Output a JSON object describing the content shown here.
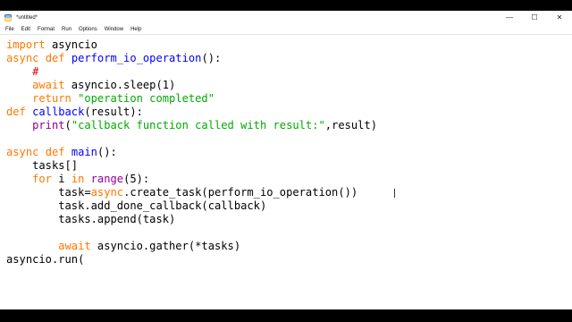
{
  "window": {
    "title": "*untitled*",
    "controls": {
      "minimize": "—",
      "maximize": "☐",
      "close": "✕"
    }
  },
  "menu": [
    "File",
    "Edit",
    "Format",
    "Run",
    "Options",
    "Window",
    "Help"
  ],
  "code": {
    "l1": {
      "a": "import",
      "b": " asyncio"
    },
    "l2": {
      "a": "async",
      "b": " ",
      "c": "def",
      "d": " ",
      "e": "perform_io_operation",
      "f": "():"
    },
    "l3": {
      "a": "    ",
      "b": "#"
    },
    "l4": {
      "a": "    ",
      "b": "await",
      "c": " asyncio.sleep(1)"
    },
    "l5": {
      "a": "    ",
      "b": "return",
      "c": " ",
      "d": "\"operation completed\""
    },
    "l6": {
      "a": "def",
      "b": " ",
      "c": "callback",
      "d": "(result):"
    },
    "l7": {
      "a": "    ",
      "b": "print",
      "c": "(",
      "d": "\"callback function called with result:\"",
      "e": ",result)"
    },
    "l8": {
      "a": "async",
      "b": " ",
      "c": "def",
      "d": " ",
      "e": "main",
      "f": "():"
    },
    "l9": {
      "a": "    tasks[]"
    },
    "l10": {
      "a": "    ",
      "b": "for",
      "c": " i ",
      "d": "in",
      "e": " ",
      "f": "range",
      "g": "(5):"
    },
    "l11": {
      "a": "        task=",
      "b": "async",
      "c": ".create_task(perform_io_operation())"
    },
    "l12": {
      "a": "        task.add_done_callback(callback)"
    },
    "l13": {
      "a": "        tasks.append(task)"
    },
    "l14": {
      "a": "        ",
      "b": "await",
      "c": " asyncio.gather(*tasks)"
    },
    "l15": {
      "a": "asyncio.run("
    }
  }
}
